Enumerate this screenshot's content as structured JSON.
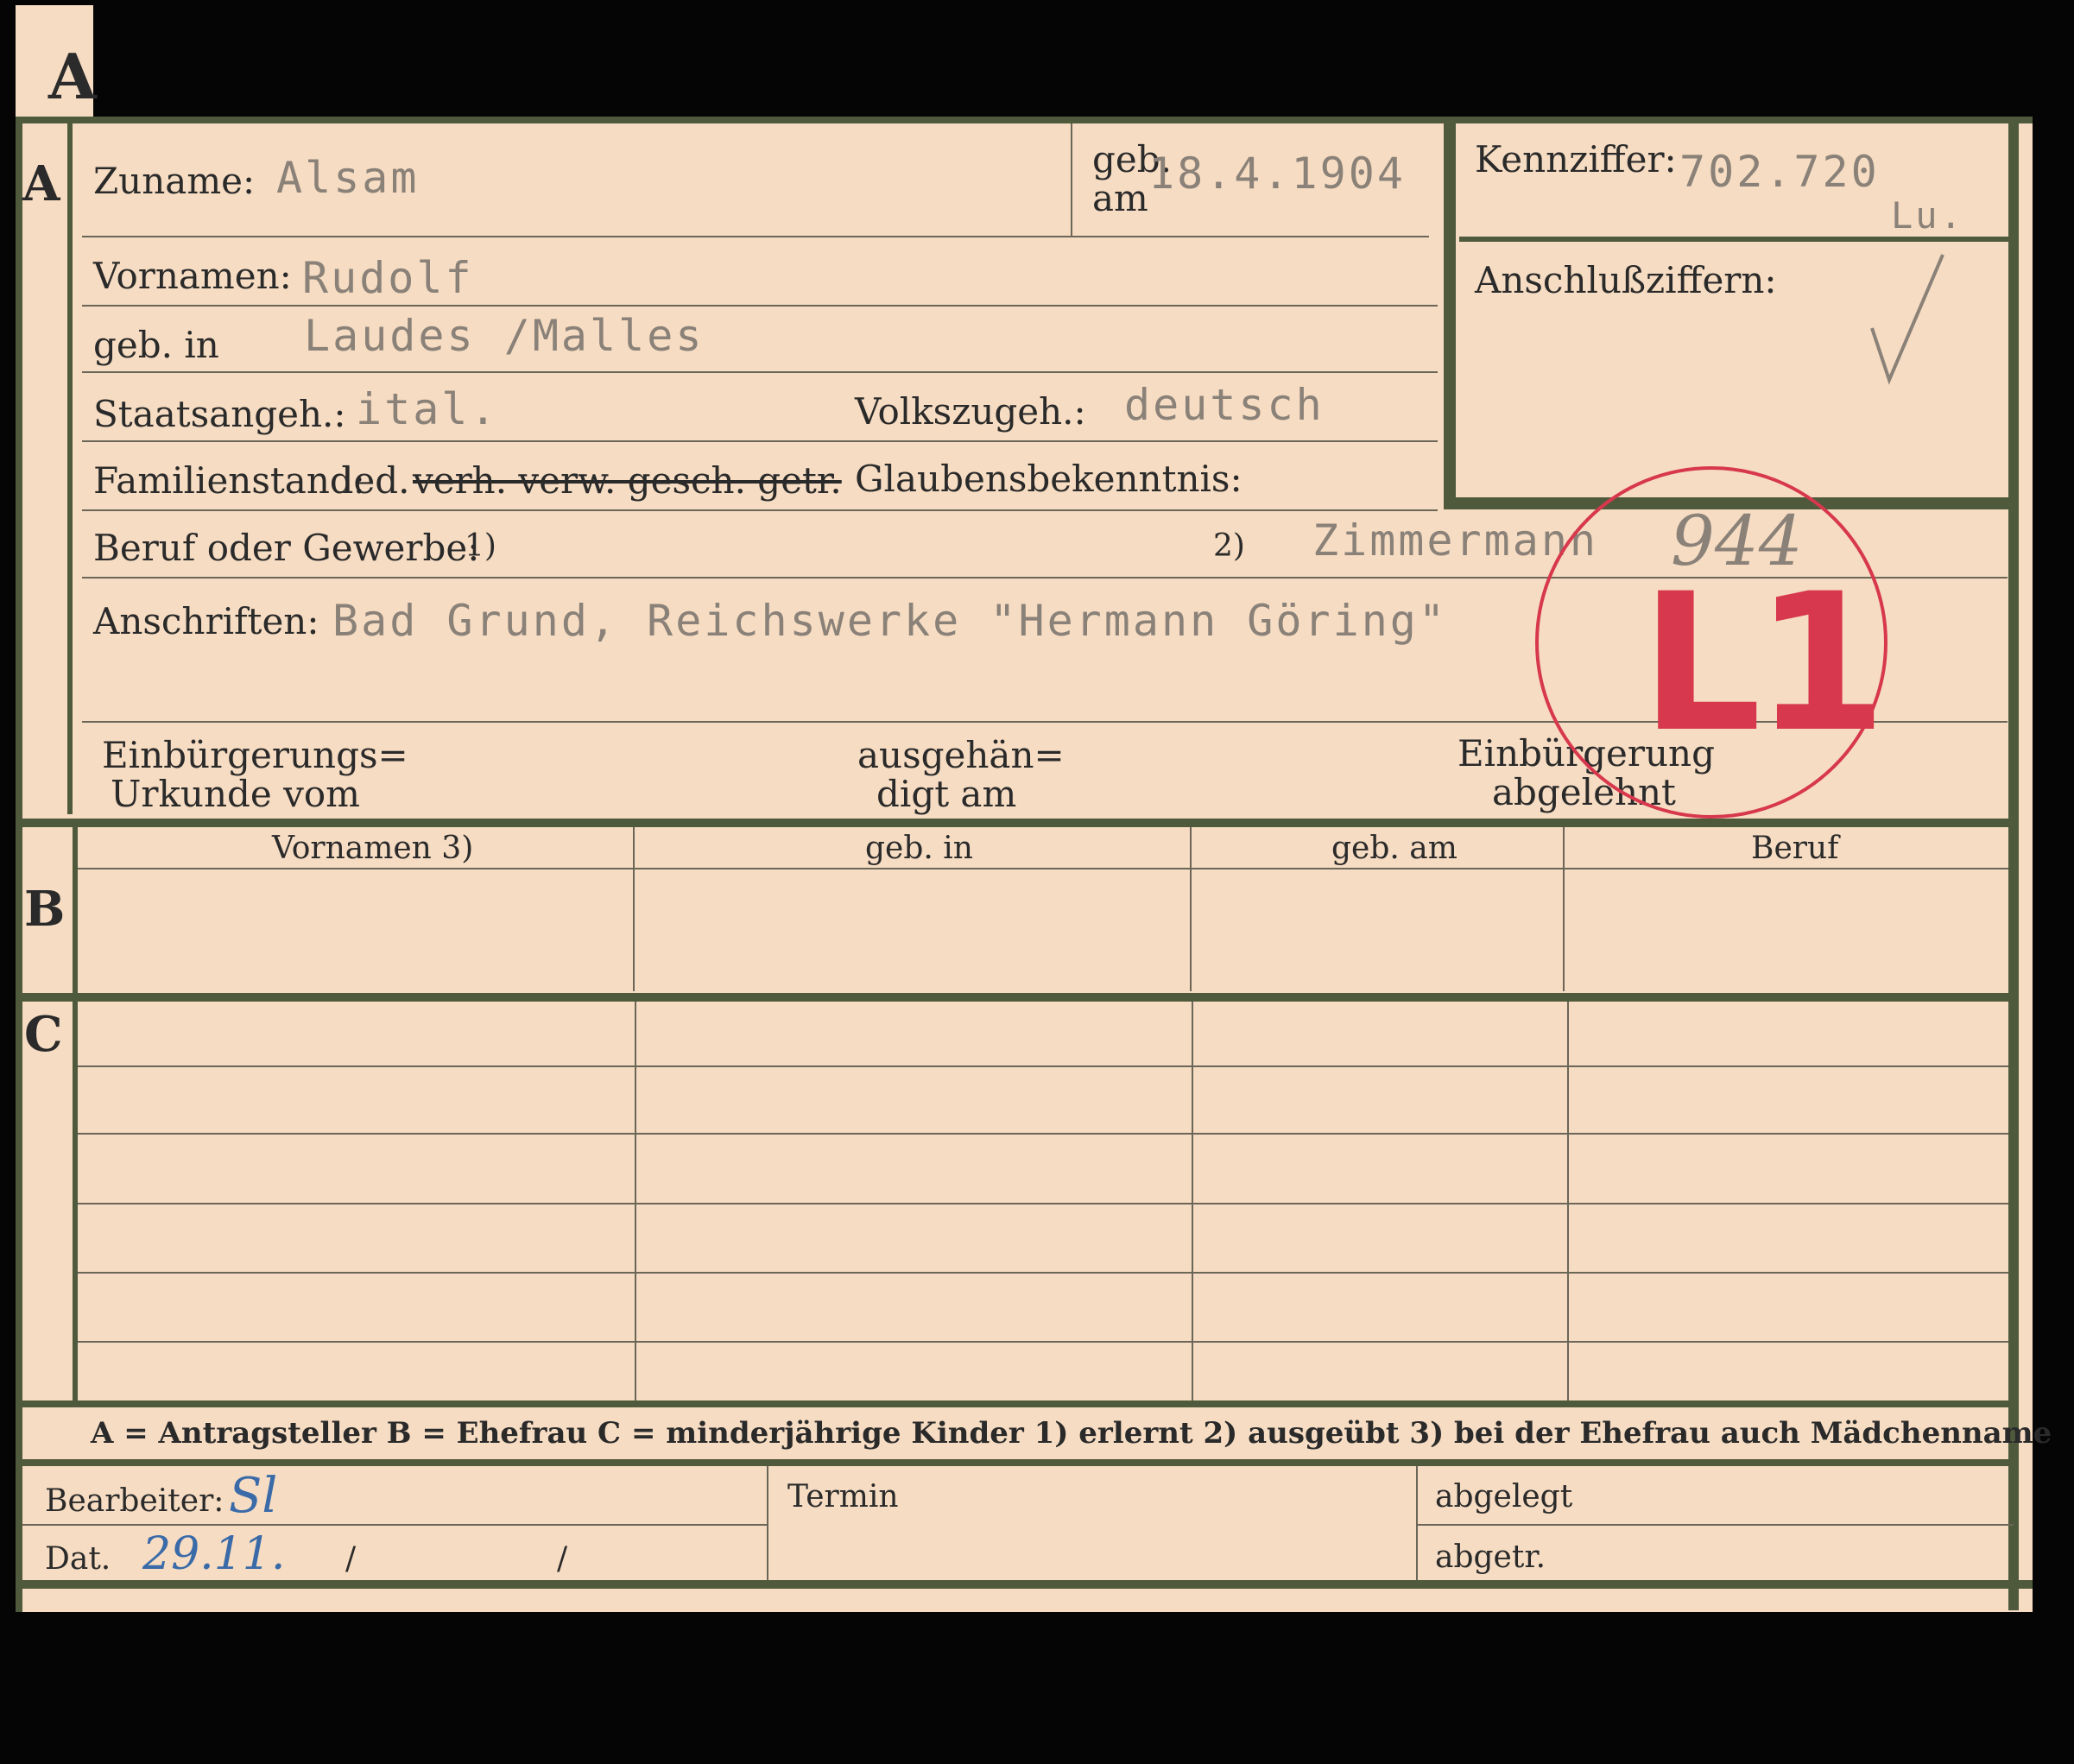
{
  "tab": {
    "letter": "A"
  },
  "sections": {
    "a": "A",
    "b": "B",
    "c": "C"
  },
  "labels": {
    "zuname": "Zuname:",
    "geb_am_1": "geb.",
    "geb_am_2": "am",
    "kennziffer": "Kennziffer:",
    "vornamen": "Vornamen:",
    "anschlussziffern": "Anschlußziffern:",
    "geb_in": "geb. in",
    "staatsangeh": "Staatsangeh.:",
    "volkszugeh": "Volkszugeh.:",
    "familienstand": "Familienstand:",
    "fam_led": "led.",
    "fam_struck": "verh. verw. gesch. getr.",
    "glaubensbekenntnis": "Glaubensbekenntnis:",
    "beruf": "Beruf oder Gewerbe:",
    "beruf_note1": "1)",
    "beruf_note2": "2)",
    "anschriften": "Anschriften:",
    "einbuergerung_1": "Einbürgerungs=",
    "einbuergerung_2": "Urkunde vom",
    "ausgehaendigt_1": "ausgehän=",
    "ausgehaendigt_2": "digt am",
    "abgelehnt_1": "Einbürgerung",
    "abgelehnt_2": "abgelehnt",
    "termin": "Termin",
    "abgelegt": "abgelegt",
    "abgetr": "abgetr.",
    "bearbeiter": "Bearbeiter:",
    "dat": "Dat.",
    "dat_slash1": "/",
    "dat_slash2": "/"
  },
  "table_headers": [
    "Vornamen 3)",
    "geb. in",
    "geb. am",
    "Beruf"
  ],
  "legend": "A = Antragsteller   B = Ehefrau   C = minderjährige Kinder   1) erlernt   2) ausgeübt   3) bei der Ehefrau auch Mädchenname",
  "values": {
    "zuname": "Alsam",
    "geb_am": "18.4.1904",
    "kennziffer": "702.720",
    "kennziffer_suffix": "Lu.",
    "vornamen": "Rudolf",
    "geb_in": "Laudes /Malles",
    "staatsangeh": "ital.",
    "volkszugeh": "deutsch",
    "beruf": "Zimmermann",
    "anschriften": "Bad Grund, Reichswerke \"Hermann Göring\""
  },
  "handwritten": {
    "bearbeiter": "Sl",
    "dat": "29.11.",
    "pencil_number": "944"
  },
  "stamp": {
    "text": "L1",
    "color": "#d7384d"
  },
  "colors": {
    "card": "#f6dcc2",
    "border": "#4f5a3d",
    "typed": "#8a8178",
    "ink_blue": "#3a6aa8"
  }
}
